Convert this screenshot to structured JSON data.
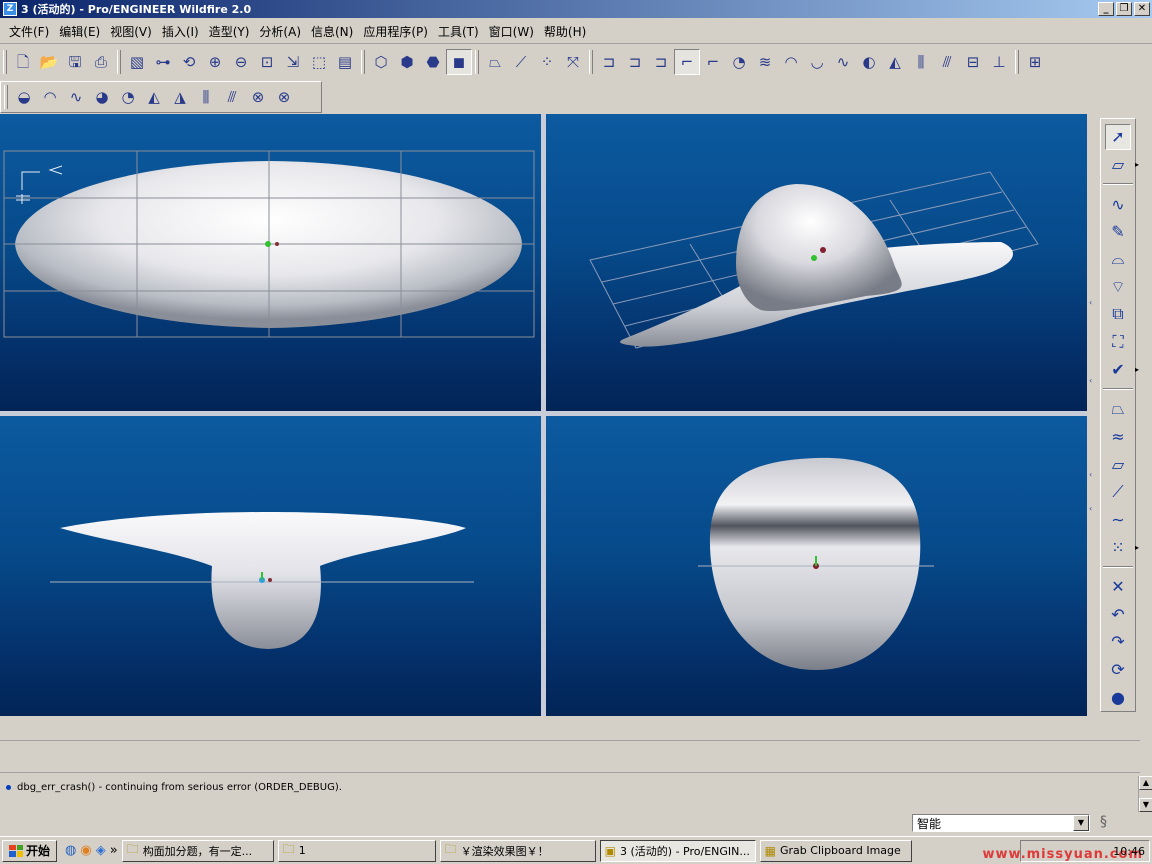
{
  "window": {
    "title": "3 (活动的) - Pro/ENGINEER Wildfire 2.0",
    "app_icon": "pro-e-icon",
    "minimize": "_",
    "restore": "❐",
    "close": "✕"
  },
  "menu": [
    "文件(F)",
    "编辑(E)",
    "视图(V)",
    "插入(I)",
    "造型(Y)",
    "分析(A)",
    "信息(N)",
    "应用程序(P)",
    "工具(T)",
    "窗口(W)",
    "帮助(H)"
  ],
  "toolbar1": {
    "group1": [
      {
        "icon": "new-file-icon",
        "glyph": "🗋"
      },
      {
        "icon": "open-folder-icon",
        "glyph": "📂"
      },
      {
        "icon": "save-icon",
        "glyph": "🖫"
      },
      {
        "icon": "print-icon",
        "glyph": "⎙"
      }
    ],
    "group2": [
      {
        "icon": "redraw-icon",
        "glyph": "▧"
      },
      {
        "icon": "spin-center-icon",
        "glyph": "⊶"
      },
      {
        "icon": "orient-mode-icon",
        "glyph": "⟲"
      },
      {
        "icon": "zoom-in-icon",
        "glyph": "⊕"
      },
      {
        "icon": "zoom-out-icon",
        "glyph": "⊖"
      },
      {
        "icon": "refit-icon",
        "glyph": "⊡"
      },
      {
        "icon": "reorient-icon",
        "glyph": "⇲"
      },
      {
        "icon": "saved-views-icon",
        "glyph": "⬚"
      },
      {
        "icon": "layers-icon",
        "glyph": "▤"
      }
    ],
    "group3": [
      {
        "icon": "wireframe-icon",
        "glyph": "⬡"
      },
      {
        "icon": "hidden-line-icon",
        "glyph": "⬢"
      },
      {
        "icon": "no-hidden-icon",
        "glyph": "⬣"
      },
      {
        "icon": "shading-icon",
        "glyph": "◼"
      }
    ],
    "group4": [
      {
        "icon": "datum-planes-icon",
        "glyph": "⏢"
      },
      {
        "icon": "datum-axes-icon",
        "glyph": "⟋"
      },
      {
        "icon": "datum-points-icon",
        "glyph": "⁘"
      },
      {
        "icon": "coord-sys-icon",
        "glyph": "⤧"
      }
    ],
    "group5": [
      {
        "icon": "surface-analysis-1-icon",
        "glyph": "⊐"
      },
      {
        "icon": "surface-analysis-2-icon",
        "glyph": "⊐"
      },
      {
        "icon": "surface-analysis-3-icon",
        "glyph": "⊐"
      },
      {
        "icon": "surface-analysis-4-icon",
        "glyph": "⌐"
      },
      {
        "icon": "surface-analysis-5-icon",
        "glyph": "⌐"
      },
      {
        "icon": "shade-analysis-icon",
        "glyph": "◔"
      },
      {
        "icon": "curvature-icon",
        "glyph": "≋"
      },
      {
        "icon": "reflection-icon",
        "glyph": "◠"
      },
      {
        "icon": "highlight-icon",
        "glyph": "◡"
      },
      {
        "icon": "curve-analysis-icon",
        "glyph": "∿"
      },
      {
        "icon": "draft-analysis-icon",
        "glyph": "◐"
      },
      {
        "icon": "slope-analysis-icon",
        "glyph": "◭"
      },
      {
        "icon": "section-analysis-icon",
        "glyph": "⫼"
      },
      {
        "icon": "offset-analysis-icon",
        "glyph": "⫻"
      },
      {
        "icon": "deviation-icon",
        "glyph": "⊟"
      },
      {
        "icon": "dihedral-icon",
        "glyph": "⊥"
      }
    ],
    "group6": [
      {
        "icon": "model-tree-icon",
        "glyph": "⊞"
      }
    ]
  },
  "toolbar2": [
    {
      "icon": "curvature-2-icon",
      "glyph": "◒"
    },
    {
      "icon": "reflection-2-icon",
      "glyph": "◠"
    },
    {
      "icon": "curve-2-icon",
      "glyph": "∿"
    },
    {
      "icon": "color-map-icon",
      "glyph": "◕"
    },
    {
      "icon": "shade-2-icon",
      "glyph": "◔"
    },
    {
      "icon": "draft-2-icon",
      "glyph": "◭"
    },
    {
      "icon": "slope-2-icon",
      "glyph": "◮"
    },
    {
      "icon": "section-2-icon",
      "glyph": "⫼"
    },
    {
      "icon": "offset-2-icon",
      "glyph": "⫻"
    },
    {
      "icon": "delete-analysis-icon",
      "glyph": "⊗"
    },
    {
      "icon": "delete-all-analysis-icon",
      "glyph": "⊗"
    }
  ],
  "right_toolbar": {
    "group1": [
      {
        "icon": "select-arrow-icon",
        "glyph": "➚",
        "arrow": false
      },
      {
        "icon": "active-plane-icon",
        "glyph": "▱",
        "arrow": true
      }
    ],
    "group2": [
      {
        "icon": "curve-icon",
        "glyph": "∿",
        "arrow": false
      },
      {
        "icon": "curve-edit-icon",
        "glyph": "✎",
        "arrow": false
      },
      {
        "icon": "boundary-surface-icon",
        "glyph": "⌓",
        "arrow": false
      },
      {
        "icon": "connect-surface-icon",
        "glyph": "⌔",
        "arrow": false
      },
      {
        "icon": "trim-surface-icon",
        "glyph": "⧉",
        "arrow": false
      },
      {
        "icon": "surface-edit-icon",
        "glyph": "⛶",
        "arrow": false
      },
      {
        "icon": "done-check-icon",
        "glyph": "✔",
        "arrow": true
      }
    ],
    "group3": [
      {
        "icon": "plane-icon",
        "glyph": "⏢",
        "arrow": false
      },
      {
        "icon": "curve-on-surface-icon",
        "glyph": "≈",
        "arrow": false
      },
      {
        "icon": "datum-plane-icon",
        "glyph": "▱",
        "arrow": false
      },
      {
        "icon": "axis-icon",
        "glyph": "⟋",
        "arrow": false
      },
      {
        "icon": "sketched-curve-icon",
        "glyph": "∼",
        "arrow": false
      },
      {
        "icon": "point-icon",
        "glyph": "⁙",
        "arrow": true
      }
    ],
    "group4": [
      {
        "icon": "cancel-icon",
        "glyph": "✕",
        "arrow": false
      },
      {
        "icon": "undo-icon",
        "glyph": "↶",
        "arrow": false
      },
      {
        "icon": "redo-icon",
        "glyph": "↷",
        "arrow": false
      },
      {
        "icon": "regenerate-icon",
        "glyph": "⟳",
        "arrow": false
      },
      {
        "icon": "status-light-icon",
        "glyph": "●",
        "arrow": false
      }
    ]
  },
  "message": {
    "text": "dbg_err_crash() - continuing from serious error (ORDER_DEBUG)."
  },
  "status": {
    "filter_value": "智能"
  },
  "taskbar": {
    "start_label": "开始",
    "tasks": [
      {
        "label": "构面加分题，有一定...",
        "icon": "folder-icon",
        "glyph": "🗀",
        "active": false,
        "width": 152
      },
      {
        "label": "1",
        "icon": "folder-icon",
        "glyph": "🗀",
        "active": false,
        "width": 158
      },
      {
        "label": "￥渲染效果图￥！",
        "icon": "folder-icon",
        "glyph": "🗀",
        "active": false,
        "width": 156
      },
      {
        "label": "3 (活动的) - Pro/ENGIN...",
        "icon": "pro-e-task-icon",
        "glyph": "▣",
        "active": true,
        "width": 156
      },
      {
        "label": "Grab Clipboard Image",
        "icon": "grab-icon",
        "glyph": "▦",
        "active": false,
        "width": 152
      }
    ],
    "clock": "10:46",
    "watermark": "www.missyuan.com"
  },
  "colors": {
    "title_start": "#0a246a",
    "title_end": "#a6caf0",
    "viewport_top": "#0c5aa0",
    "viewport_bottom": "#022456",
    "accent_icon": "#2a3a8a"
  }
}
